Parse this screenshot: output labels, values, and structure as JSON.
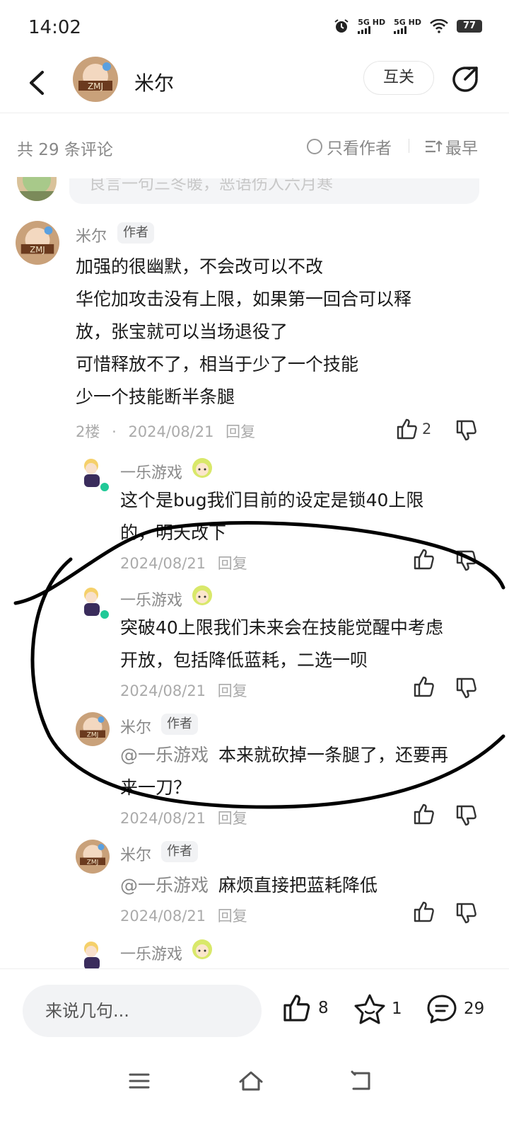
{
  "status_bar": {
    "time": "14:02",
    "network1": "5G HD",
    "network2": "5G HD",
    "battery": "77"
  },
  "header": {
    "username": "米尔",
    "follow_label": "互关"
  },
  "comments_bar": {
    "count_text": "共 29 条评论",
    "author_only_label": "只看作者",
    "sort_label": "最早"
  },
  "partial_top_comment": {
    "text": "良言一句三冬暖，恶语伤人六月寒"
  },
  "main_comment": {
    "username": "米尔",
    "tag": "作者",
    "lines": [
      "加强的很幽默，不会改可以不改",
      "华佗加攻击没有上限，如果第一回合可以释",
      "放，张宝就可以当场退役了",
      "可惜释放不了，相当于少了一个技能",
      "少一个技能断半条腿"
    ],
    "floor": "2楼",
    "date": "2024/08/21",
    "reply_label": "回复",
    "likes": "2"
  },
  "replies": [
    {
      "username": "一乐游戏",
      "lines": [
        "这个是bug我们目前的设定是锁40上限",
        "的，明天改下"
      ],
      "date": "2024/08/21",
      "reply_label": "回复"
    },
    {
      "username": "一乐游戏",
      "lines": [
        "突破40上限我们未来会在技能觉醒中考虑",
        "开放，包括降低蓝耗，二选一呗"
      ],
      "date": "2024/08/21",
      "reply_label": "回复"
    },
    {
      "username": "米尔",
      "tag": "作者",
      "mention": "@一乐游戏",
      "lines": [
        "本来就砍掉一条腿了，还要再",
        "来一刀？"
      ],
      "date": "2024/08/21",
      "reply_label": "回复"
    },
    {
      "username": "米尔",
      "tag": "作者",
      "mention": "@一乐游戏",
      "lines": [
        "麻烦直接把蓝耗降低"
      ],
      "date": "2024/08/21",
      "reply_label": "回复"
    },
    {
      "username": "一乐游戏"
    }
  ],
  "bottom_bar": {
    "input_placeholder": "来说几句...",
    "likes": "8",
    "favorites": "1",
    "comments": "29"
  }
}
